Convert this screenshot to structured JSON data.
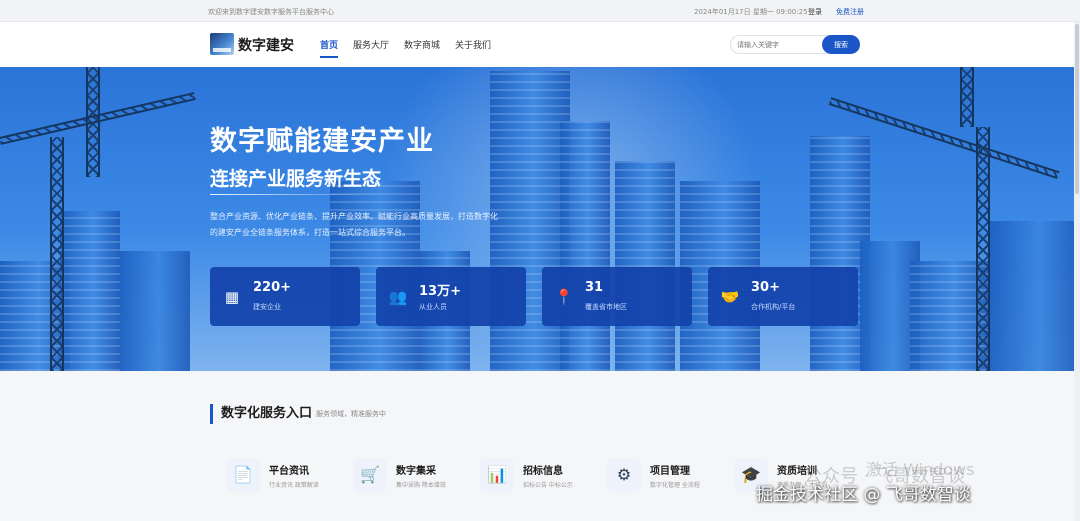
{
  "topbar": {
    "welcome": "欢迎来到数字建安数字服务平台服务中心",
    "date": "2024年01月17日 星期一 09:00:25",
    "login": "登录",
    "register": "免费注册"
  },
  "header": {
    "logo_text": "数字建安",
    "nav": [
      "首页",
      "服务大厅",
      "数字商城",
      "关于我们"
    ],
    "search_placeholder": "请输入关键字",
    "search_button": "搜索"
  },
  "hero": {
    "title": "数字赋能建安产业",
    "subtitle": "连接产业服务新生态",
    "description": "整合产业资源、优化产业链条、提升产业效率、赋能行业高质量发展，打造数字化的建安产业全链条服务体系，打造一站式综合服务平台。",
    "stats": [
      {
        "icon": "building-icon",
        "glyph": "▦",
        "value": "220+",
        "label": "建安企业"
      },
      {
        "icon": "people-icon",
        "glyph": "👥",
        "value": "13万+",
        "label": "从业人员"
      },
      {
        "icon": "location-pin-icon",
        "glyph": "📍",
        "value": "31",
        "label": "覆盖省市地区"
      },
      {
        "icon": "handshake-icon",
        "glyph": "🤝",
        "value": "30+",
        "label": "合作机构/平台"
      }
    ]
  },
  "services": {
    "title": "数字化服务入口",
    "subtitle": "服务领域，精准服务中",
    "items": [
      {
        "icon": "document-icon",
        "glyph": "📄",
        "name": "平台资讯",
        "desc": "行业资讯 政策解读"
      },
      {
        "icon": "cart-icon",
        "glyph": "🛒",
        "name": "数字集采",
        "desc": "集中采购 降本增效"
      },
      {
        "icon": "bar-chart-icon",
        "glyph": "📊",
        "name": "招标信息",
        "desc": "招标公告 中标公示"
      },
      {
        "icon": "gear-icon",
        "glyph": "⚙",
        "name": "项目管理",
        "desc": "数字化管理 全流程"
      },
      {
        "icon": "graduation-cap-icon",
        "glyph": "🎓",
        "name": "资质培训",
        "desc": "资质办理 人才培训"
      }
    ]
  },
  "watermarks": {
    "platform": "掘金技术社区 @ 飞哥数智谈",
    "wechat": "公众号 · 飞哥数智谈",
    "activation": "激活 Windows"
  }
}
